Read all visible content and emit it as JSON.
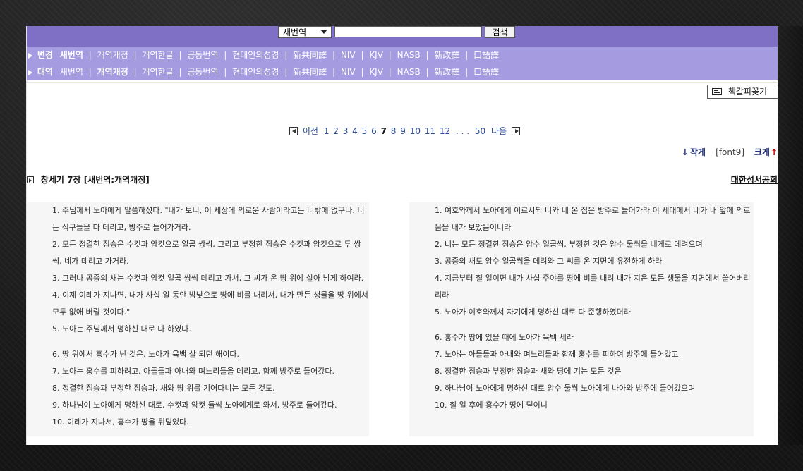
{
  "top_search": {
    "select_value": "새번역",
    "search_placeholder": "",
    "search_button": "검색"
  },
  "nav": {
    "row1": {
      "label": "변경",
      "items": [
        "새번역",
        "개역개정",
        "개역한글",
        "공동번역",
        "현대인의성경",
        "新共同譯",
        "NIV",
        "KJV",
        "NASB",
        "新改譯",
        "口語譯"
      ],
      "active_index": 0
    },
    "row2": {
      "label": "대역",
      "items": [
        "새번역",
        "개역개정",
        "개역한글",
        "공동번역",
        "현대인의성경",
        "新共同譯",
        "NIV",
        "KJV",
        "NASB",
        "新改譯",
        "口語譯"
      ],
      "active_index": 1
    }
  },
  "bookmark": {
    "label": "책갈피꽂기"
  },
  "pagination": {
    "prev_label": "이전",
    "pages": [
      "1",
      "2",
      "3",
      "4",
      "5",
      "6",
      "7",
      "8",
      "9",
      "10",
      "11",
      "12"
    ],
    "current_page": "7",
    "ellipsis": ". . .",
    "last_page": "50",
    "next_label": "다음"
  },
  "font_controls": {
    "small_label": "작게",
    "current": "[font9]",
    "big_label": "크게"
  },
  "chapter": {
    "title": "창세기 7장 [새번역:개역개정]",
    "publisher": "대한성서공회"
  },
  "left_verses": [
    "1. 주님께서 노아에게 말씀하셨다. \"내가 보니, 이 세상에 의로운 사람이라고는 너밖에 없구나. 너는 식구들을 다 데리고, 방주로 들어가거라.",
    "2. 모든 정결한 짐승은 수컷과 암컷으로 일곱 쌍씩, 그리고 부정한 짐승은 수컷과 암컷으로 두 쌍씩, 네가 데리고 가거라.",
    "3. 그러나 공중의 새는 수컷과 암컷 일곱 쌍씩 데리고 가서, 그 씨가 온 땅 위에 살아 남게 하여라.",
    "4. 이제 이레가 지나면, 내가 사십 일 동안 밤낮으로 땅에 비를 내려서, 내가 만든 생물을 땅 위에서 모두 없애 버릴 것이다.\"",
    "5. 노아는 주님께서 명하신 대로 다 하였다.",
    "6. 땅 위에서 홍수가 난 것은, 노아가 육백 살 되던 해이다.",
    "7. 노아는 홍수를 피하려고, 아들들과 아내와 며느리들을 데리고, 함께 방주로 들어갔다.",
    "8. 정결한 짐승과 부정한 짐승과, 새와 땅 위를 기어다니는 모든 것도,",
    "9. 하나님이 노아에게 명하신 대로, 수컷과 암컷 둘씩 노아에게로 와서, 방주로 들어갔다.",
    "10. 이레가 지나서, 홍수가 땅을 뒤덮었다."
  ],
  "right_verses": [
    "1. 여호와께서 노아에게 이르시되 너와 네 온 집은 방주로 들어가라 이 세대에서 네가 내 앞에 의로움을 내가 보았음이니라",
    "2. 너는 모든 정결한 짐승은 암수 일곱씩, 부정한 것은 암수 둘씩을 네게로 데려오며",
    "3. 공중의 새도 암수 일곱씩을 데려와 그 씨를 온 지면에 유전하게 하라",
    "4. 지금부터 칠 일이면 내가 사십 주야를 땅에 비를 내려 내가 지은 모든 생물을 지면에서 쓸어버리리라",
    "5. 노아가 여호와께서 자기에게 명하신 대로 다 준행하였더라",
    "6. 홍수가 땅에 있을 때에 노아가 육백 세라",
    "7. 노아는 아들들과 아내와 며느리들과 함께 홍수를 피하여 방주에 들어갔고",
    "8. 정결한 짐승과 부정한 짐승과 새와 땅에 기는 모든 것은",
    "9. 하나님이 노아에게 명하신 대로 암수 둘씩 노아에게 나아와 방주에 들어갔으며",
    "10. 칠 일 후에 홍수가 땅에 덮이니"
  ],
  "colors": {
    "topbar_bg": "#7f70c6",
    "navrows_bg": "#a49be0",
    "link_blue": "#2b4c9a",
    "keyword_blue": "#1b2f9d"
  }
}
